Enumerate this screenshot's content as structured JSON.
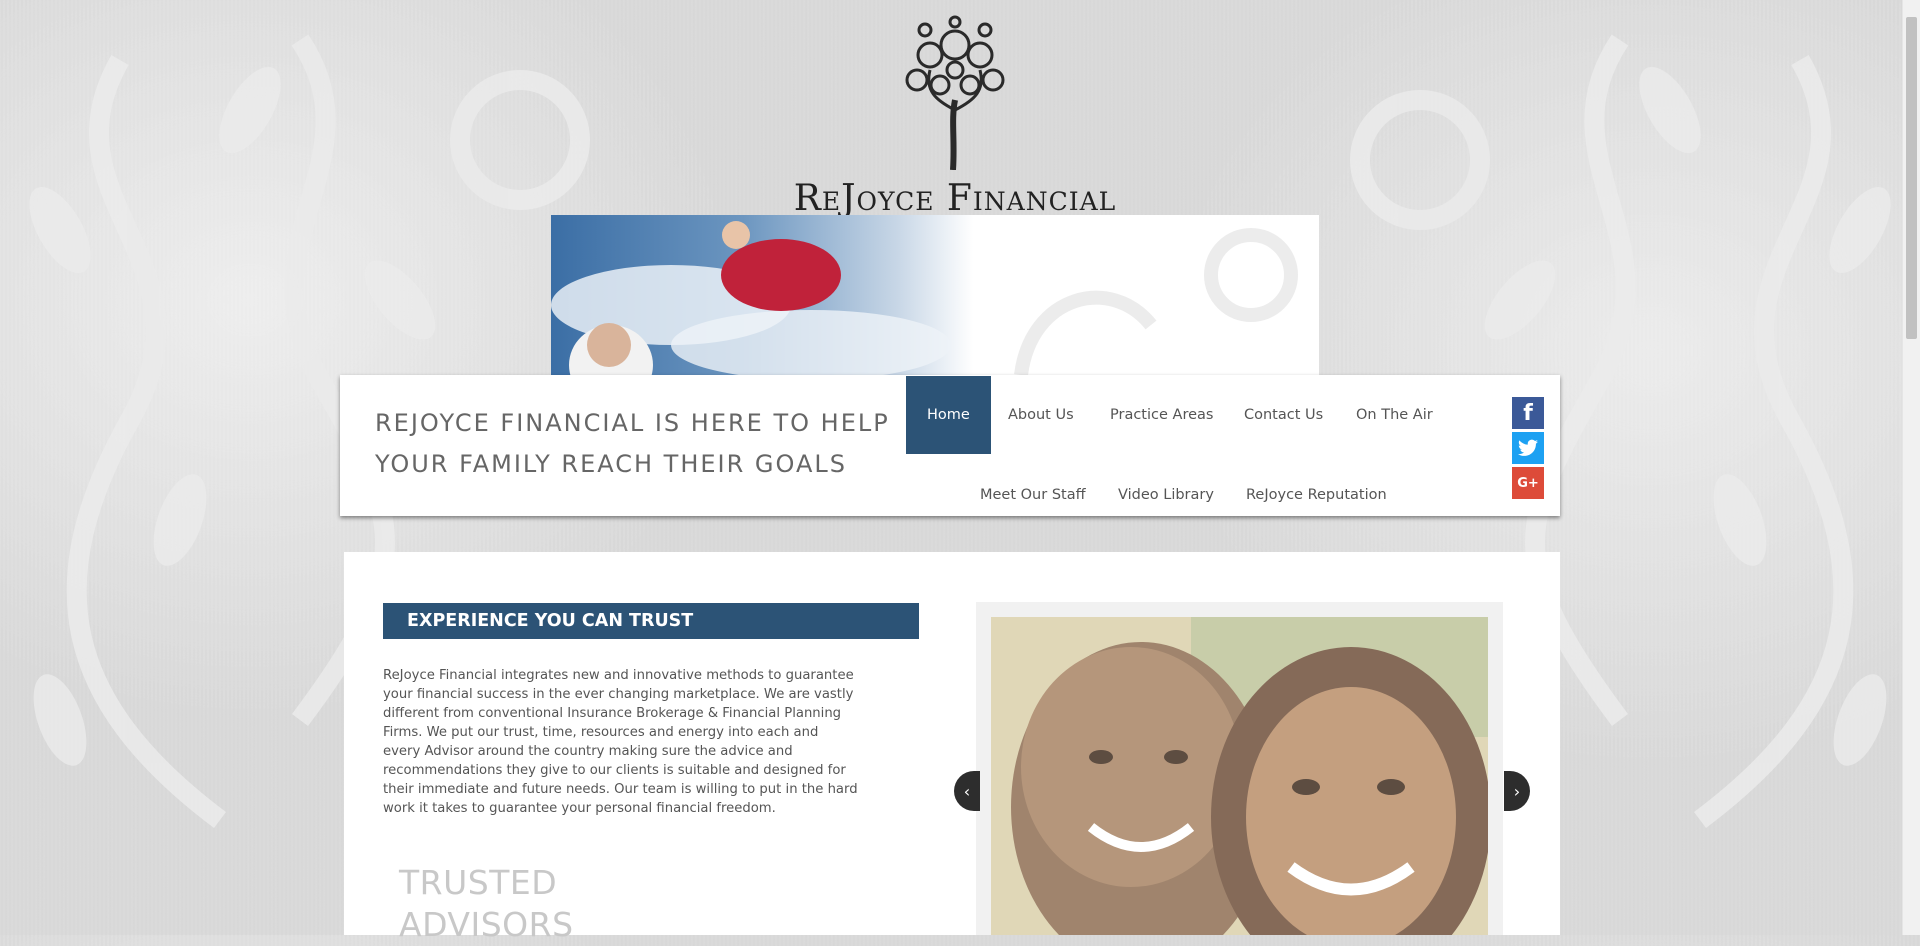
{
  "brand": {
    "name": "ReJoyce Financial"
  },
  "header": {
    "tagline_line1": "REJOYCE FINANCIAL IS HERE TO HELP",
    "tagline_line2": "YOUR FAMILY REACH THEIR GOALS"
  },
  "nav": {
    "items": [
      {
        "label": "Home",
        "active": true
      },
      {
        "label": "About Us"
      },
      {
        "label": "Practice Areas"
      },
      {
        "label": "Contact Us"
      },
      {
        "label": "On The Air"
      },
      {
        "label": "Meet Our Staff"
      },
      {
        "label": "Video Library"
      },
      {
        "label": "ReJoyce Reputation"
      }
    ]
  },
  "social": {
    "facebook": {
      "icon": "facebook-icon",
      "glyph": "f",
      "color": "#3b5998"
    },
    "twitter": {
      "icon": "twitter-icon",
      "color": "#1da1f2"
    },
    "googleplus": {
      "icon": "google-plus-icon",
      "glyph": "G+",
      "color": "#dd4b39"
    }
  },
  "main": {
    "section_title": "EXPERIENCE YOU CAN TRUST",
    "body": "ReJoyce Financial integrates new and innovative methods to guarantee your financial success in the ever changing marketplace. We are vastly different from conventional Insurance Brokerage & Financial Planning Firms. We put our trust, time, resources and energy into each and every Advisor around the country making sure the advice and recommendations they give to our clients is suitable and designed for their immediate and future needs. Our team is willing to put in the hard work it takes to guarantee your personal financial freedom.",
    "trusted_line1": "TRUSTED",
    "trusted_line2": "ADVISORS"
  },
  "slider": {
    "prev_glyph": "‹",
    "next_glyph": "›"
  },
  "colors": {
    "accent": "#2c5376",
    "text": "#555555"
  }
}
